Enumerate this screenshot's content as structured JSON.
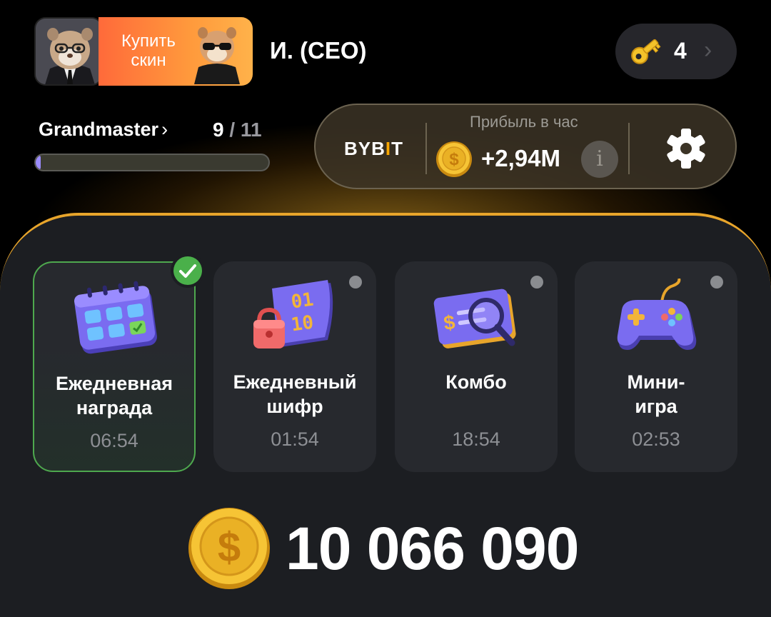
{
  "header": {
    "buy_skin_label_line1": "Купить",
    "buy_skin_label_line2": "скин",
    "username": "И. (CEO)",
    "keys_count": "4"
  },
  "level": {
    "name": "Grandmaster",
    "current": "9",
    "separator": " / ",
    "total": "11",
    "progress_fraction": 0.02
  },
  "profit": {
    "exchange": "BYBIT",
    "title": "Прибыль в час",
    "value": "+2,94M"
  },
  "cards": [
    {
      "title_line1": "Ежедневная",
      "title_line2": "награда",
      "timer": "06:54",
      "completed": true
    },
    {
      "title_line1": "Ежедневный",
      "title_line2": "шифр",
      "timer": "01:54",
      "completed": false
    },
    {
      "title_line1": "Комбо",
      "title_line2": "",
      "timer": "18:54",
      "completed": false
    },
    {
      "title_line1": "Мини-",
      "title_line2": "игра",
      "timer": "02:53",
      "completed": false
    }
  ],
  "balance": "10 066 090",
  "colors": {
    "accent_gold": "#e8a52b",
    "panel_bg": "#1c1e22",
    "card_bg": "#27292e",
    "completed_green": "#4ea84e",
    "skin_button": "#ff8a3c"
  }
}
